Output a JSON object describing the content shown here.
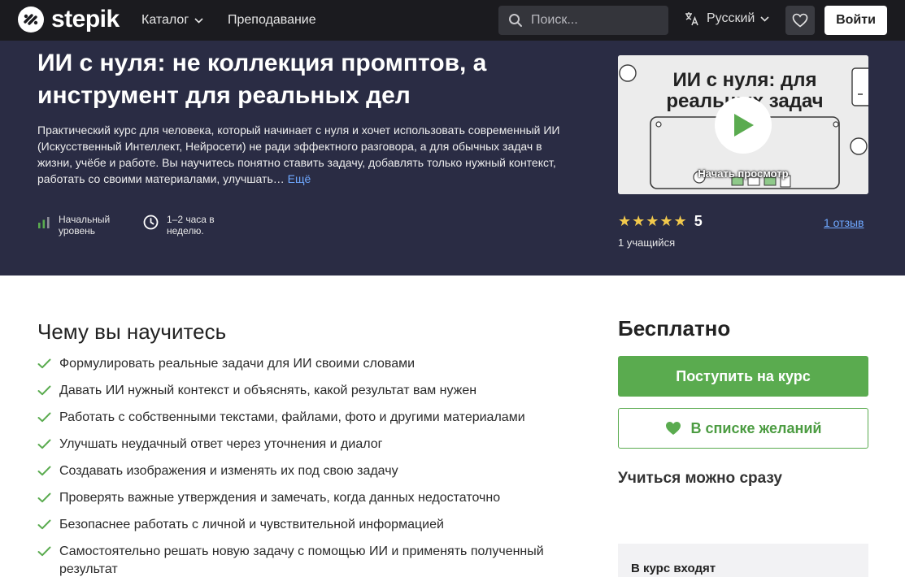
{
  "brand": {
    "name": "stepik"
  },
  "nav": {
    "catalog_label": "Каталог",
    "teaching_label": "Преподавание",
    "search_placeholder": "Поиск...",
    "language_label": "Русский",
    "login_label": "Войти"
  },
  "course": {
    "title": "ИИ с нуля: не коллекция промптов, а инструмент для реальных дел",
    "description": "Практический курс для человека, который начинает с нуля и хочет использовать современный ИИ (Искусственный Интеллект, Нейросети) не ради эффектного разговора, а для обычных задач в жизни, учёбе и работе. Вы научитесь понятно ставить задачу, добавлять только нужный контекст, работать со своими материалами, улучшать…",
    "more_label": "Ещё",
    "level_line1": "Начальный",
    "level_line2": "уровень",
    "time_line1": "1–2 часа в",
    "time_line2": "неделю.",
    "video_thumb_title": "ИИ с нуля: для реальных задач",
    "video_play_label": "Начать просмотр",
    "stars": "★★★★★",
    "rating": "5",
    "reviews_label": "1 отзыв",
    "learners_label": "1 учащийся"
  },
  "learn": {
    "title": "Чему вы научитесь",
    "items": [
      "Формулировать реальные задачи для ИИ своими словами",
      "Давать ИИ нужный контекст и объяснять, какой результат вам нужен",
      "Работать с собственными текстами, файлами, фото и другими материалами",
      "Улучшать неудачный ответ через уточнения и диалог",
      "Создавать изображения и изменять их под свою задачу",
      "Проверять важные утверждения и замечать, когда данных недостаточно",
      "Безопаснее работать с личной и чувствительной информацией",
      "Самостоятельно решать новую задачу с помощью ИИ и применять полученный результат"
    ]
  },
  "sidebar": {
    "price": "Бесплатно",
    "enroll_label": "Поступить на курс",
    "wishlist_label": "В списке желаний",
    "start_now": "Учиться можно сразу",
    "includes_title": "В курс входят"
  },
  "colors": {
    "nav_bg": "#1b1b1f",
    "hero_bg": "#2a2c44",
    "accent_green": "#5aab4f",
    "link_blue": "#6fa8ff",
    "star_gold": "#f2c94c"
  }
}
